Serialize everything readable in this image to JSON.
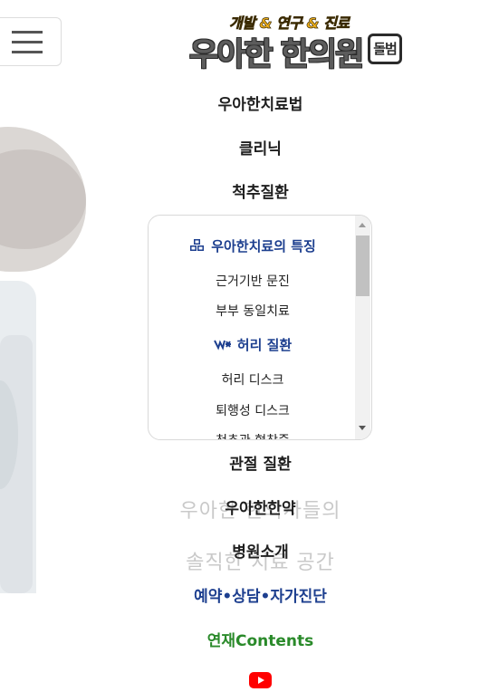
{
  "logo": {
    "tagline": "개발 & 연구 & 진료",
    "name": "우아한 한의원",
    "badge": "돌범"
  },
  "nav": {
    "item1": "우아한치료법",
    "item2": "클리닉",
    "item3": "척추질환",
    "item4": "관절 질환",
    "item5": "우아한한약",
    "item6": "병원소개",
    "item7": "예약•상담•자가진단",
    "item8": "연재Contents"
  },
  "overlay": {
    "line1": "우아한 한의사들의",
    "line2": "솔직한 치료 공간"
  },
  "dropdown": {
    "section1_title": "우아한치료의 특징",
    "section1_items": [
      "근거기반 문진",
      "부부 동일치료"
    ],
    "section2_title": "허리 질환",
    "section2_items": [
      "허리 디스크",
      "퇴행성 디스크",
      "척추관 협착증"
    ]
  },
  "colors": {
    "accent_blue": "#1d3f8f",
    "accent_green": "#2a8a2a",
    "youtube_red": "#ff0000",
    "tagline_yellow": "#f1b11c"
  },
  "icons": {
    "menu": "hamburger-icon",
    "section1": "cubes-icon",
    "section2": "spine-icon",
    "social": "youtube-icon"
  }
}
